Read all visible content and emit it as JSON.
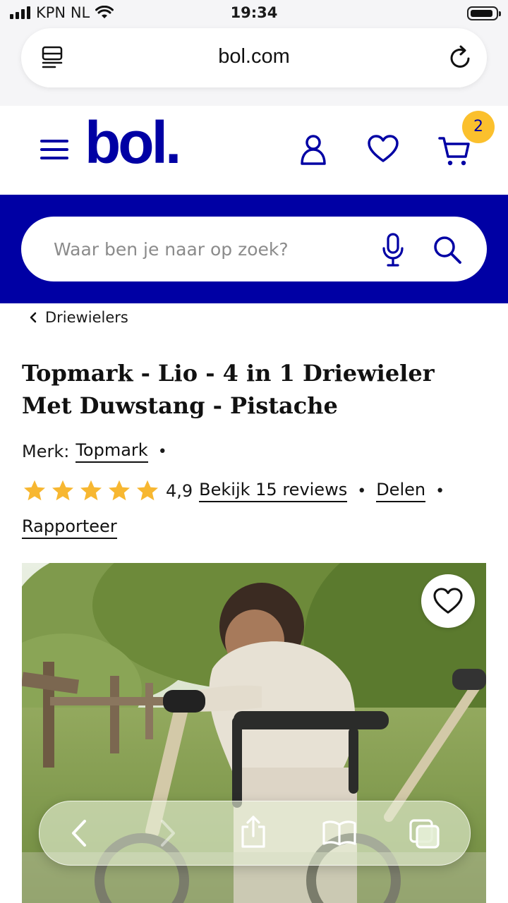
{
  "status_bar": {
    "carrier": "KPN NL",
    "time": "19:34",
    "battery_level": 0.9
  },
  "browser": {
    "url": "bol.com"
  },
  "header": {
    "logo_text": "bol.",
    "cart_count": "2"
  },
  "search": {
    "placeholder": "Waar ben je naar op zoek?"
  },
  "breadcrumb": {
    "label": "Driewielers"
  },
  "product": {
    "title": "Topmark - Lio - 4 in 1 Driewieler Met Duwstang - Pistache",
    "brand_label": "Merk:",
    "brand": "Topmark",
    "rating_value": "4,9",
    "rating_stars": 5,
    "reviews_link": "Bekijk 15 reviews",
    "share_link": "Delen",
    "report_link": "Rapporteer"
  },
  "colors": {
    "brand_blue": "#0000a4",
    "star_yellow": "#f7b731",
    "badge_yellow": "#fbc02d"
  },
  "icons": [
    "signal-icon",
    "wifi-icon",
    "battery-icon",
    "page-menu-icon",
    "reload-icon",
    "menu-icon",
    "account-icon",
    "wishlist-icon",
    "cart-icon",
    "microphone-icon",
    "search-icon",
    "chevron-left-icon",
    "star-icon",
    "heart-icon",
    "back-icon",
    "forward-icon",
    "share-icon",
    "bookmarks-icon",
    "tabs-icon"
  ]
}
